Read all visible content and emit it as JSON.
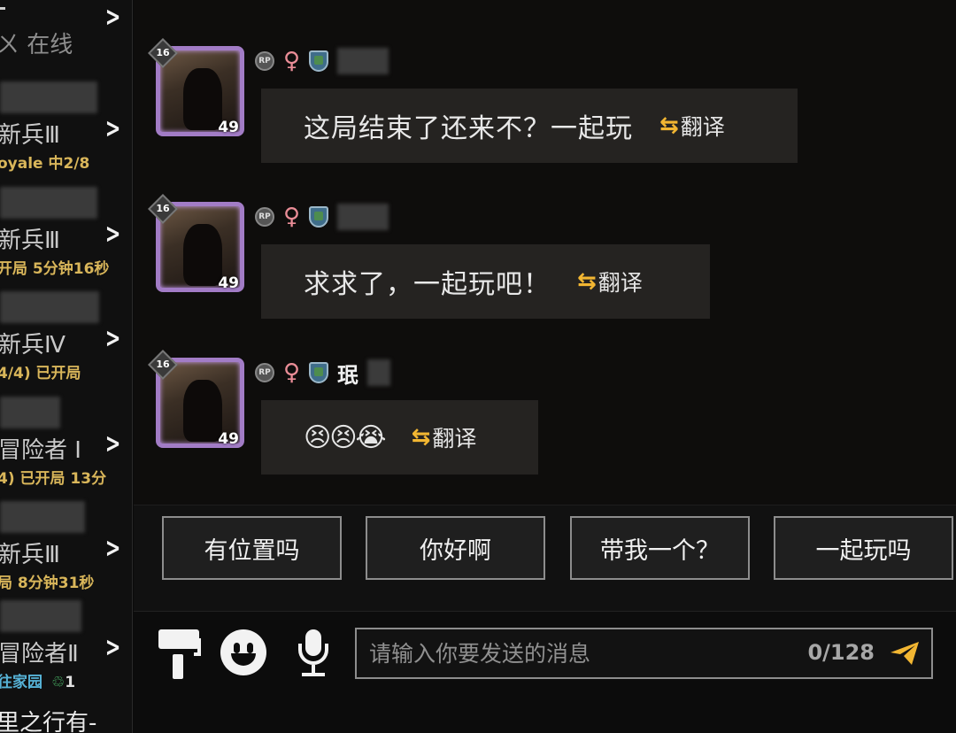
{
  "sidebar": {
    "online_label": "在线",
    "friends": [
      {
        "rank": "新兵Ⅲ",
        "status": "oyale 中2/8"
      },
      {
        "rank": "新兵Ⅲ",
        "status": "开局 5分钟16秒"
      },
      {
        "rank": "新兵Ⅳ",
        "status": "4/4) 已开局"
      },
      {
        "rank": "冒险者 I",
        "status": "4) 已开局 13分"
      },
      {
        "rank": "新兵Ⅲ",
        "status": "局 8分钟31秒"
      },
      {
        "rank": "冒险者Ⅱ",
        "status": "往家园",
        "extra": "1"
      }
    ],
    "bottom_text": "里之行有-"
  },
  "messages": [
    {
      "level": "16",
      "tier": "49",
      "badge": "RP",
      "gender": "♀",
      "sender": "",
      "text": "这局结束了还来不？一起玩",
      "translate_label": "翻译"
    },
    {
      "level": "16",
      "tier": "49",
      "badge": "RP",
      "gender": "♀",
      "sender": "",
      "text": "求求了，一起玩吧！",
      "translate_label": "翻译"
    },
    {
      "level": "16",
      "tier": "49",
      "badge": "RP",
      "gender": "♀",
      "sender": "珉",
      "text": "😣😣😭",
      "translate_label": "翻译"
    }
  ],
  "quick_replies": [
    "有位置吗",
    "你好啊",
    "带我一个？",
    "一起玩吗"
  ],
  "input": {
    "placeholder": "请输入你要发送的消息",
    "counter": "0/128"
  },
  "icons": {
    "chevron": "chevron-right-icon",
    "translate": "swap-arrows-icon",
    "paint": "paint-roller-icon",
    "emoji": "emoji-icon",
    "mic": "microphone-icon",
    "send": "send-icon"
  },
  "colors": {
    "accent_yellow": "#f2b632",
    "status_gold": "#d9b65a",
    "avatar_frame": "#a27cc6",
    "gender_pink": "#ea8d97"
  }
}
